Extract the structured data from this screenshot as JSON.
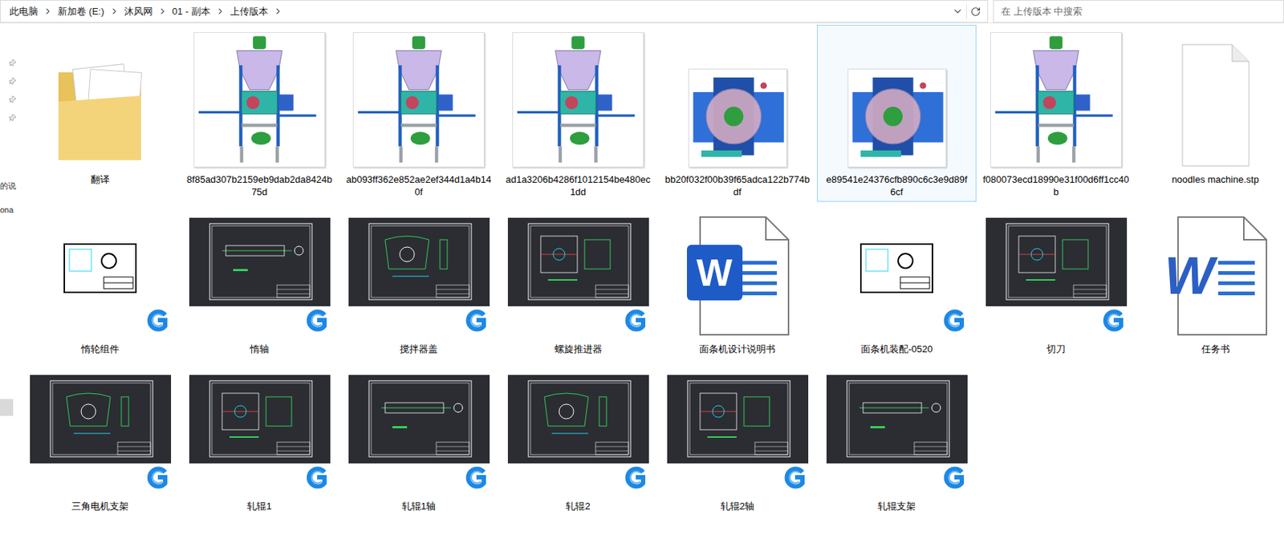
{
  "address_bar": {
    "path": [
      "此电脑",
      "新加卷 (E:)",
      "沐风网",
      "01 - 副本",
      "上传版本"
    ],
    "search_placeholder": "在 上传版本 中搜索"
  },
  "sidebar": {
    "items": [
      {
        "label": "",
        "pinned": true,
        "selected": false
      },
      {
        "label": "",
        "pinned": true,
        "selected": false
      },
      {
        "label": "",
        "pinned": true,
        "selected": false
      },
      {
        "label": "",
        "pinned": true,
        "selected": false
      },
      {
        "label": "的说",
        "pinned": false,
        "selected": false
      },
      {
        "label": "ona",
        "pinned": false,
        "selected": false
      },
      {
        "label": "",
        "pinned": false,
        "selected": true
      }
    ]
  },
  "rows": [
    [
      {
        "name": "翻译",
        "kind": "folder",
        "selected": false
      },
      {
        "name": "8f85ad307b2159eb9dab2da8424b75d",
        "kind": "render-front",
        "selected": false
      },
      {
        "name": "ab093ff362e852ae2ef344d1a4b140f",
        "kind": "render-front",
        "selected": false
      },
      {
        "name": "ad1a3206b4286f1012154be480ec1dd",
        "kind": "render-front",
        "selected": false
      },
      {
        "name": "bb20f032f00b39f65adca122b774bdf",
        "kind": "render-top",
        "selected": false
      },
      {
        "name": "e89541e24376cfb890c6c3e9d89f6cf",
        "kind": "render-top",
        "selected": true
      },
      {
        "name": "f080073ecd18990e31f00d6ff1cc40b",
        "kind": "render-front",
        "selected": false
      },
      {
        "name": "noodles machine.stp",
        "kind": "file",
        "selected": false
      }
    ],
    [
      {
        "name": "惰轮组件",
        "kind": "dwg-small",
        "selected": false
      },
      {
        "name": "惰轴",
        "kind": "dwg",
        "selected": false
      },
      {
        "name": "搅拌器盖",
        "kind": "dwg",
        "selected": false
      },
      {
        "name": "螺旋推进器",
        "kind": "dwg",
        "selected": false
      },
      {
        "name": "面条机设计说明书",
        "kind": "word",
        "selected": false,
        "icon_text": "W"
      },
      {
        "name": "面条机装配-0520",
        "kind": "dwg-small",
        "selected": false
      },
      {
        "name": "切刀",
        "kind": "dwg",
        "selected": false
      },
      {
        "name": "任务书",
        "kind": "word-old",
        "selected": false,
        "icon_text": "W"
      }
    ],
    [
      {
        "name": "三角电机支架",
        "kind": "dwg",
        "selected": false
      },
      {
        "name": "轧辊1",
        "kind": "dwg",
        "selected": false
      },
      {
        "name": "轧辊1轴",
        "kind": "dwg",
        "selected": false
      },
      {
        "name": "轧辊2",
        "kind": "dwg",
        "selected": false
      },
      {
        "name": "轧辊2轴",
        "kind": "dwg",
        "selected": false
      },
      {
        "name": "轧辊支架",
        "kind": "dwg",
        "selected": false
      }
    ]
  ]
}
